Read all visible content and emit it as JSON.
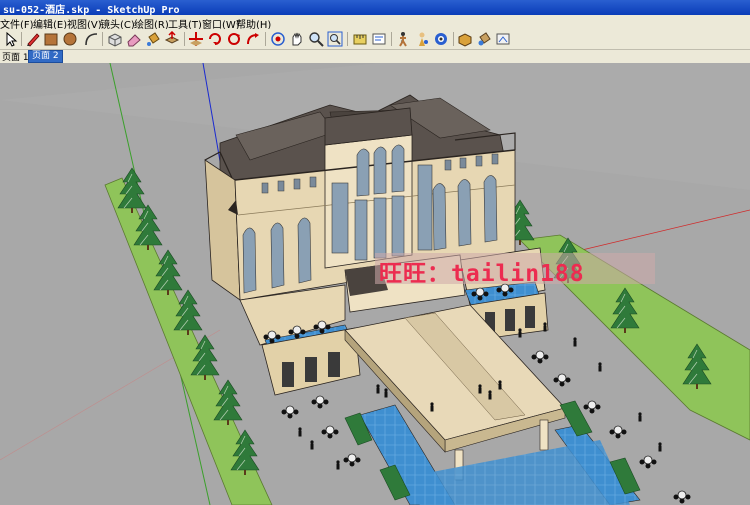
{
  "window": {
    "title": "su-052-酒店.skp - SketchUp Pro"
  },
  "menu": [
    {
      "label": "文件(F)"
    },
    {
      "label": "编辑(E)"
    },
    {
      "label": "视图(V)"
    },
    {
      "label": "镜头(C)"
    },
    {
      "label": "绘图(R)"
    },
    {
      "label": "工具(T)"
    },
    {
      "label": "窗口(W)"
    },
    {
      "label": "帮助(H)"
    }
  ],
  "toolbar": {
    "icons": [
      "select-icon",
      "pencil-icon",
      "rectangle-icon",
      "circle-icon",
      "arc-icon",
      "make-component-icon",
      "eraser-icon",
      "paint-bucket-icon",
      "push-pull-icon",
      "move-icon",
      "rotate-icon",
      "follow-me-icon",
      "orbit-icon",
      "pan-icon",
      "zoom-icon",
      "zoom-extents-icon",
      "tape-measure-icon",
      "text-icon",
      "walk-icon",
      "position-camera-icon",
      "look-around-icon",
      "components-icon",
      "materials-icon",
      "styles-icon"
    ]
  },
  "pages": {
    "label": "页面 1",
    "tabs": [
      {
        "label": "页面 2",
        "active": true
      }
    ]
  },
  "viewport": {
    "watermark": "旺旺：tailin188",
    "colors": {
      "ground": "#a8a8a8",
      "grass": "#8fc45a",
      "building_wall": "#e7d7b3",
      "roof": "#5a524d",
      "glass": "#8aa0b4",
      "water": "#3f8fd0",
      "canopy": "#e8d9b8",
      "tree": "#2f7a3a"
    }
  }
}
